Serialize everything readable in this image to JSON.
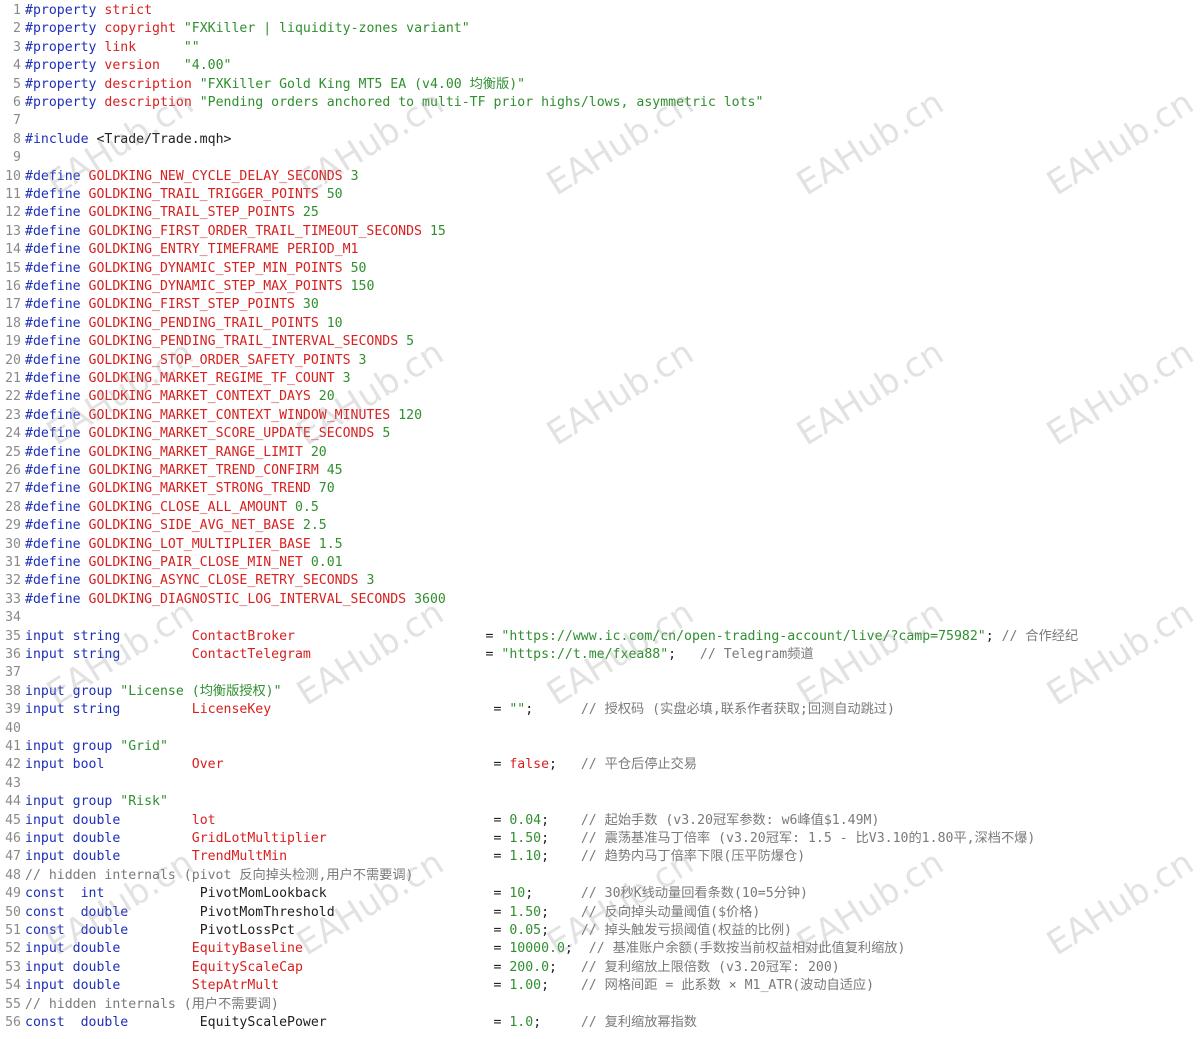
{
  "watermark": "EAHub.cn",
  "lines": [
    {
      "n": "1",
      "segs": [
        [
          "kw",
          "#property"
        ],
        [
          "plain",
          " "
        ],
        [
          "mac",
          "strict"
        ]
      ]
    },
    {
      "n": "2",
      "segs": [
        [
          "kw",
          "#property"
        ],
        [
          "plain",
          " "
        ],
        [
          "mac",
          "copyright"
        ],
        [
          "plain",
          " "
        ],
        [
          "str",
          "\"FXKiller | liquidity-zones variant\""
        ]
      ]
    },
    {
      "n": "3",
      "segs": [
        [
          "kw",
          "#property"
        ],
        [
          "plain",
          " "
        ],
        [
          "mac",
          "link"
        ],
        [
          "plain",
          "      "
        ],
        [
          "str",
          "\"\""
        ]
      ]
    },
    {
      "n": "4",
      "segs": [
        [
          "kw",
          "#property"
        ],
        [
          "plain",
          " "
        ],
        [
          "mac",
          "version"
        ],
        [
          "plain",
          "   "
        ],
        [
          "str",
          "\"4.00\""
        ]
      ]
    },
    {
      "n": "5",
      "segs": [
        [
          "kw",
          "#property"
        ],
        [
          "plain",
          " "
        ],
        [
          "mac",
          "description"
        ],
        [
          "plain",
          " "
        ],
        [
          "str",
          "\"FXKiller Gold King MT5 EA (v4.00 均衡版)\""
        ]
      ]
    },
    {
      "n": "6",
      "segs": [
        [
          "kw",
          "#property"
        ],
        [
          "plain",
          " "
        ],
        [
          "mac",
          "description"
        ],
        [
          "plain",
          " "
        ],
        [
          "str",
          "\"Pending orders anchored to multi-TF prior highs/lows, asymmetric lots\""
        ]
      ]
    },
    {
      "n": "7",
      "segs": []
    },
    {
      "n": "8",
      "segs": [
        [
          "kw",
          "#include"
        ],
        [
          "plain",
          " <Trade/Trade.mqh>"
        ]
      ]
    },
    {
      "n": "9",
      "segs": []
    },
    {
      "n": "10",
      "segs": [
        [
          "kw",
          "#define"
        ],
        [
          "plain",
          " "
        ],
        [
          "mac",
          "GOLDKING_NEW_CYCLE_DELAY_SECONDS"
        ],
        [
          "plain",
          " "
        ],
        [
          "num",
          "3"
        ]
      ]
    },
    {
      "n": "11",
      "segs": [
        [
          "kw",
          "#define"
        ],
        [
          "plain",
          " "
        ],
        [
          "mac",
          "GOLDKING_TRAIL_TRIGGER_POINTS"
        ],
        [
          "plain",
          " "
        ],
        [
          "num",
          "50"
        ]
      ]
    },
    {
      "n": "12",
      "segs": [
        [
          "kw",
          "#define"
        ],
        [
          "plain",
          " "
        ],
        [
          "mac",
          "GOLDKING_TRAIL_STEP_POINTS"
        ],
        [
          "plain",
          " "
        ],
        [
          "num",
          "25"
        ]
      ]
    },
    {
      "n": "13",
      "segs": [
        [
          "kw",
          "#define"
        ],
        [
          "plain",
          " "
        ],
        [
          "mac",
          "GOLDKING_FIRST_ORDER_TRAIL_TIMEOUT_SECONDS"
        ],
        [
          "plain",
          " "
        ],
        [
          "num",
          "15"
        ]
      ]
    },
    {
      "n": "14",
      "segs": [
        [
          "kw",
          "#define"
        ],
        [
          "plain",
          " "
        ],
        [
          "mac",
          "GOLDKING_ENTRY_TIMEFRAME PERIOD_M1"
        ]
      ]
    },
    {
      "n": "15",
      "segs": [
        [
          "kw",
          "#define"
        ],
        [
          "plain",
          " "
        ],
        [
          "mac",
          "GOLDKING_DYNAMIC_STEP_MIN_POINTS"
        ],
        [
          "plain",
          " "
        ],
        [
          "num",
          "50"
        ]
      ]
    },
    {
      "n": "16",
      "segs": [
        [
          "kw",
          "#define"
        ],
        [
          "plain",
          " "
        ],
        [
          "mac",
          "GOLDKING_DYNAMIC_STEP_MAX_POINTS"
        ],
        [
          "plain",
          " "
        ],
        [
          "num",
          "150"
        ]
      ]
    },
    {
      "n": "17",
      "segs": [
        [
          "kw",
          "#define"
        ],
        [
          "plain",
          " "
        ],
        [
          "mac",
          "GOLDKING_FIRST_STEP_POINTS"
        ],
        [
          "plain",
          " "
        ],
        [
          "num",
          "30"
        ]
      ]
    },
    {
      "n": "18",
      "segs": [
        [
          "kw",
          "#define"
        ],
        [
          "plain",
          " "
        ],
        [
          "mac",
          "GOLDKING_PENDING_TRAIL_POINTS"
        ],
        [
          "plain",
          " "
        ],
        [
          "num",
          "10"
        ]
      ]
    },
    {
      "n": "19",
      "segs": [
        [
          "kw",
          "#define"
        ],
        [
          "plain",
          " "
        ],
        [
          "mac",
          "GOLDKING_PENDING_TRAIL_INTERVAL_SECONDS"
        ],
        [
          "plain",
          " "
        ],
        [
          "num",
          "5"
        ]
      ]
    },
    {
      "n": "20",
      "segs": [
        [
          "kw",
          "#define"
        ],
        [
          "plain",
          " "
        ],
        [
          "mac",
          "GOLDKING_STOP_ORDER_SAFETY_POINTS"
        ],
        [
          "plain",
          " "
        ],
        [
          "num",
          "3"
        ]
      ]
    },
    {
      "n": "21",
      "segs": [
        [
          "kw",
          "#define"
        ],
        [
          "plain",
          " "
        ],
        [
          "mac",
          "GOLDKING_MARKET_REGIME_TF_COUNT"
        ],
        [
          "plain",
          " "
        ],
        [
          "num",
          "3"
        ]
      ]
    },
    {
      "n": "22",
      "segs": [
        [
          "kw",
          "#define"
        ],
        [
          "plain",
          " "
        ],
        [
          "mac",
          "GOLDKING_MARKET_CONTEXT_DAYS"
        ],
        [
          "plain",
          " "
        ],
        [
          "num",
          "20"
        ]
      ]
    },
    {
      "n": "23",
      "segs": [
        [
          "kw",
          "#define"
        ],
        [
          "plain",
          " "
        ],
        [
          "mac",
          "GOLDKING_MARKET_CONTEXT_WINDOW_MINUTES"
        ],
        [
          "plain",
          " "
        ],
        [
          "num",
          "120"
        ]
      ]
    },
    {
      "n": "24",
      "segs": [
        [
          "kw",
          "#define"
        ],
        [
          "plain",
          " "
        ],
        [
          "mac",
          "GOLDKING_MARKET_SCORE_UPDATE_SECONDS"
        ],
        [
          "plain",
          " "
        ],
        [
          "num",
          "5"
        ]
      ]
    },
    {
      "n": "25",
      "segs": [
        [
          "kw",
          "#define"
        ],
        [
          "plain",
          " "
        ],
        [
          "mac",
          "GOLDKING_MARKET_RANGE_LIMIT"
        ],
        [
          "plain",
          " "
        ],
        [
          "num",
          "20"
        ]
      ]
    },
    {
      "n": "26",
      "segs": [
        [
          "kw",
          "#define"
        ],
        [
          "plain",
          " "
        ],
        [
          "mac",
          "GOLDKING_MARKET_TREND_CONFIRM"
        ],
        [
          "plain",
          " "
        ],
        [
          "num",
          "45"
        ]
      ]
    },
    {
      "n": "27",
      "segs": [
        [
          "kw",
          "#define"
        ],
        [
          "plain",
          " "
        ],
        [
          "mac",
          "GOLDKING_MARKET_STRONG_TREND"
        ],
        [
          "plain",
          " "
        ],
        [
          "num",
          "70"
        ]
      ]
    },
    {
      "n": "28",
      "segs": [
        [
          "kw",
          "#define"
        ],
        [
          "plain",
          " "
        ],
        [
          "mac",
          "GOLDKING_CLOSE_ALL_AMOUNT"
        ],
        [
          "plain",
          " "
        ],
        [
          "num",
          "0.5"
        ]
      ]
    },
    {
      "n": "29",
      "segs": [
        [
          "kw",
          "#define"
        ],
        [
          "plain",
          " "
        ],
        [
          "mac",
          "GOLDKING_SIDE_AVG_NET_BASE"
        ],
        [
          "plain",
          " "
        ],
        [
          "num",
          "2.5"
        ]
      ]
    },
    {
      "n": "30",
      "segs": [
        [
          "kw",
          "#define"
        ],
        [
          "plain",
          " "
        ],
        [
          "mac",
          "GOLDKING_LOT_MULTIPLIER_BASE"
        ],
        [
          "plain",
          " "
        ],
        [
          "num",
          "1.5"
        ]
      ]
    },
    {
      "n": "31",
      "segs": [
        [
          "kw",
          "#define"
        ],
        [
          "plain",
          " "
        ],
        [
          "mac",
          "GOLDKING_PAIR_CLOSE_MIN_NET"
        ],
        [
          "plain",
          " "
        ],
        [
          "num",
          "0.01"
        ]
      ]
    },
    {
      "n": "32",
      "segs": [
        [
          "kw",
          "#define"
        ],
        [
          "plain",
          " "
        ],
        [
          "mac",
          "GOLDKING_ASYNC_CLOSE_RETRY_SECONDS"
        ],
        [
          "plain",
          " "
        ],
        [
          "num",
          "3"
        ]
      ]
    },
    {
      "n": "33",
      "segs": [
        [
          "kw",
          "#define"
        ],
        [
          "plain",
          " "
        ],
        [
          "mac",
          "GOLDKING_DIAGNOSTIC_LOG_INTERVAL_SECONDS"
        ],
        [
          "plain",
          " "
        ],
        [
          "num",
          "3600"
        ]
      ]
    },
    {
      "n": "34",
      "segs": []
    },
    {
      "n": "35",
      "segs": [
        [
          "kw",
          "input string"
        ],
        [
          "plain",
          "         "
        ],
        [
          "prm",
          "ContactBroker"
        ],
        [
          "plain",
          "                        = "
        ],
        [
          "str",
          "\"https://www.ic.com/cn/open-trading-account/live/?camp=75982\""
        ],
        [
          "plain",
          "; "
        ],
        [
          "cm",
          "// 合作经纪"
        ]
      ]
    },
    {
      "n": "36",
      "segs": [
        [
          "kw",
          "input string"
        ],
        [
          "plain",
          "         "
        ],
        [
          "prm",
          "ContactTelegram"
        ],
        [
          "plain",
          "                      = "
        ],
        [
          "str",
          "\"https://t.me/fxea88\""
        ],
        [
          "plain",
          ";   "
        ],
        [
          "cm",
          "// Telegram频道"
        ]
      ]
    },
    {
      "n": "37",
      "segs": []
    },
    {
      "n": "38",
      "segs": [
        [
          "kw",
          "input group"
        ],
        [
          "plain",
          " "
        ],
        [
          "str",
          "\"License (均衡版授权)\""
        ]
      ]
    },
    {
      "n": "39",
      "segs": [
        [
          "kw",
          "input string"
        ],
        [
          "plain",
          "         "
        ],
        [
          "prm",
          "LicenseKey"
        ],
        [
          "plain",
          "                            = "
        ],
        [
          "str",
          "\"\""
        ],
        [
          "plain",
          ";      "
        ],
        [
          "cm",
          "// 授权码 (实盘必填,联系作者获取;回测自动跳过)"
        ]
      ]
    },
    {
      "n": "40",
      "segs": []
    },
    {
      "n": "41",
      "segs": [
        [
          "kw",
          "input group"
        ],
        [
          "plain",
          " "
        ],
        [
          "str",
          "\"Grid\""
        ]
      ]
    },
    {
      "n": "42",
      "segs": [
        [
          "kw",
          "input bool"
        ],
        [
          "plain",
          "           "
        ],
        [
          "prm",
          "Over"
        ],
        [
          "plain",
          "                                  = "
        ],
        [
          "mac",
          "false"
        ],
        [
          "plain",
          ";   "
        ],
        [
          "cm",
          "// 平仓后停止交易"
        ]
      ]
    },
    {
      "n": "43",
      "segs": []
    },
    {
      "n": "44",
      "segs": [
        [
          "kw",
          "input group"
        ],
        [
          "plain",
          " "
        ],
        [
          "str",
          "\"Risk\""
        ]
      ]
    },
    {
      "n": "45",
      "segs": [
        [
          "kw",
          "input double"
        ],
        [
          "plain",
          "         "
        ],
        [
          "prm",
          "lot"
        ],
        [
          "plain",
          "                                   = "
        ],
        [
          "num",
          "0.04"
        ],
        [
          "plain",
          ";    "
        ],
        [
          "cm",
          "// 起始手数 (v3.20冠军参数: w6峰值$1.49M)"
        ]
      ]
    },
    {
      "n": "46",
      "segs": [
        [
          "kw",
          "input double"
        ],
        [
          "plain",
          "         "
        ],
        [
          "prm",
          "GridLotMultiplier"
        ],
        [
          "plain",
          "                     = "
        ],
        [
          "num",
          "1.50"
        ],
        [
          "plain",
          ";    "
        ],
        [
          "cm",
          "// 震荡基准马丁倍率 (v3.20冠军: 1.5 - 比V3.10的1.80平,深档不爆)"
        ]
      ]
    },
    {
      "n": "47",
      "segs": [
        [
          "kw",
          "input double"
        ],
        [
          "plain",
          "         "
        ],
        [
          "prm",
          "TrendMultMin"
        ],
        [
          "plain",
          "                          = "
        ],
        [
          "num",
          "1.10"
        ],
        [
          "plain",
          ";    "
        ],
        [
          "cm",
          "// 趋势内马丁倍率下限(压平防爆仓)"
        ]
      ]
    },
    {
      "n": "48",
      "segs": [
        [
          "cm",
          "// hidden internals (pivot 反向掉头检测,用户不需要调)"
        ]
      ]
    },
    {
      "n": "49",
      "segs": [
        [
          "kw",
          "const  int"
        ],
        [
          "plain",
          "            "
        ],
        [
          "plain",
          "PivotMomLookback"
        ],
        [
          "plain",
          "                     = "
        ],
        [
          "num",
          "10"
        ],
        [
          "plain",
          ";      "
        ],
        [
          "cm",
          "// 30秒K线动量回看条数(10=5分钟)"
        ]
      ]
    },
    {
      "n": "50",
      "segs": [
        [
          "kw",
          "const  double"
        ],
        [
          "plain",
          "         "
        ],
        [
          "plain",
          "PivotMomThreshold"
        ],
        [
          "plain",
          "                    = "
        ],
        [
          "num",
          "1.50"
        ],
        [
          "plain",
          ";    "
        ],
        [
          "cm",
          "// 反向掉头动量阈值($价格)"
        ]
      ]
    },
    {
      "n": "51",
      "segs": [
        [
          "kw",
          "const  double"
        ],
        [
          "plain",
          "         "
        ],
        [
          "plain",
          "PivotLossPct"
        ],
        [
          "plain",
          "                         = "
        ],
        [
          "num",
          "0.05"
        ],
        [
          "plain",
          ";    "
        ],
        [
          "cm",
          "// 掉头触发亏损阈值(权益的比例)"
        ]
      ]
    },
    {
      "n": "52",
      "segs": [
        [
          "kw",
          "input double"
        ],
        [
          "plain",
          "         "
        ],
        [
          "prm",
          "EquityBaseline"
        ],
        [
          "plain",
          "                        = "
        ],
        [
          "num",
          "10000.0"
        ],
        [
          "plain",
          ";  "
        ],
        [
          "cm",
          "// 基准账户余额(手数按当前权益相对此值复利缩放)"
        ]
      ]
    },
    {
      "n": "53",
      "segs": [
        [
          "kw",
          "input double"
        ],
        [
          "plain",
          "         "
        ],
        [
          "prm",
          "EquityScaleCap"
        ],
        [
          "plain",
          "                        = "
        ],
        [
          "num",
          "200.0"
        ],
        [
          "plain",
          ";   "
        ],
        [
          "cm",
          "// 复利缩放上限倍数 (v3.20冠军: 200)"
        ]
      ]
    },
    {
      "n": "54",
      "segs": [
        [
          "kw",
          "input double"
        ],
        [
          "plain",
          "         "
        ],
        [
          "prm",
          "StepAtrMult"
        ],
        [
          "plain",
          "                           = "
        ],
        [
          "num",
          "1.00"
        ],
        [
          "plain",
          ";    "
        ],
        [
          "cm",
          "// 网格间距 = 此系数 × M1_ATR(波动自适应)"
        ]
      ]
    },
    {
      "n": "55",
      "segs": [
        [
          "cm",
          "// hidden internals (用户不需要调)"
        ]
      ]
    },
    {
      "n": "56",
      "segs": [
        [
          "kw",
          "const  double"
        ],
        [
          "plain",
          "         "
        ],
        [
          "plain",
          "EquityScalePower"
        ],
        [
          "plain",
          "                     = "
        ],
        [
          "num",
          "1.0"
        ],
        [
          "plain",
          ";     "
        ],
        [
          "cm",
          "// 复利缩放幂指数"
        ]
      ]
    }
  ]
}
